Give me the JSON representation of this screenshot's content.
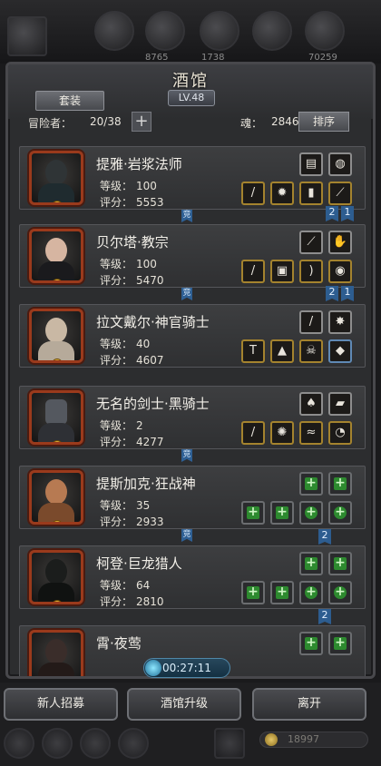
{
  "top_bar": {
    "resources": [
      "8765",
      "1738",
      "70259"
    ]
  },
  "header": {
    "title": "酒馆",
    "level": "LV.48",
    "set_button": "套装",
    "adventurers_label": "冒险者：",
    "adventurers_value": "20/38",
    "add_icon": "plus-icon",
    "soul_label": "魂：",
    "soul_value": "2846",
    "sort_button": "排序"
  },
  "heroes": [
    {
      "name": "提雅·岩浆法师",
      "level_label": "等级：",
      "level": "100",
      "score_label": "评分：",
      "score": "5553"
    },
    {
      "name": "贝尔塔·教宗",
      "level_label": "等级：",
      "level": "100",
      "score_label": "评分：",
      "score": "5470"
    },
    {
      "name": "拉文戴尔·神官骑士",
      "level_label": "等级：",
      "level": "40",
      "score_label": "评分：",
      "score": "4607"
    },
    {
      "name": "无名的剑士·黑骑士",
      "level_label": "等级：",
      "level": "2",
      "score_label": "评分：",
      "score": "4277"
    },
    {
      "name": "提斯加克·狂战神",
      "level_label": "等级：",
      "level": "35",
      "score_label": "评分：",
      "score": "2933"
    },
    {
      "name": "柯登·巨龙猎人",
      "level_label": "等级：",
      "level": "64",
      "score_label": "评分：",
      "score": "2810"
    },
    {
      "name": "霄·夜莺",
      "level_label": "",
      "level": "",
      "score_label": "",
      "score": ""
    }
  ],
  "markers": {
    "duel": "竞",
    "tag2": "2",
    "tag1": "1"
  },
  "timer": "00:27:11",
  "buttons": {
    "recruit": "新人招募",
    "upgrade": "酒馆升级",
    "leave": "离开"
  },
  "gold": "18997",
  "colors": {
    "portrait_border": "#9a3a1c",
    "item_border": "#a4832e",
    "tag_blue": "#2d5d90",
    "plus_green": "#2d8a2f"
  }
}
